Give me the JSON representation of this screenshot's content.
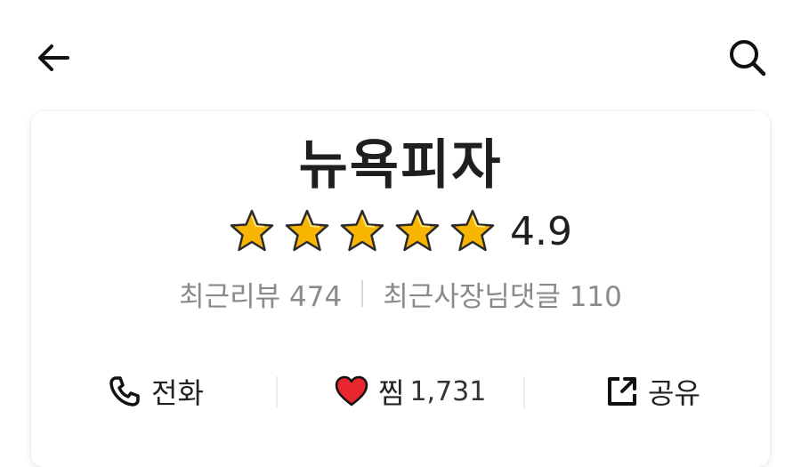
{
  "header": {
    "back_icon": "arrow-left-icon",
    "search_icon": "search-icon"
  },
  "store": {
    "name": "뉴욕피자",
    "rating": "4.9",
    "rating_value": 4.9,
    "stars_filled": 5,
    "stars_total": 5,
    "recent_reviews": "최근리뷰 474",
    "recent_owner_replies": "최근사장님댓글 110"
  },
  "actions": {
    "call_label": "전화",
    "like_label": "찜",
    "like_count": "1,731",
    "share_label": "공유"
  },
  "colors": {
    "star": "#F7B500",
    "heart": "#E8262F",
    "muted_text": "#8A8A8A"
  }
}
